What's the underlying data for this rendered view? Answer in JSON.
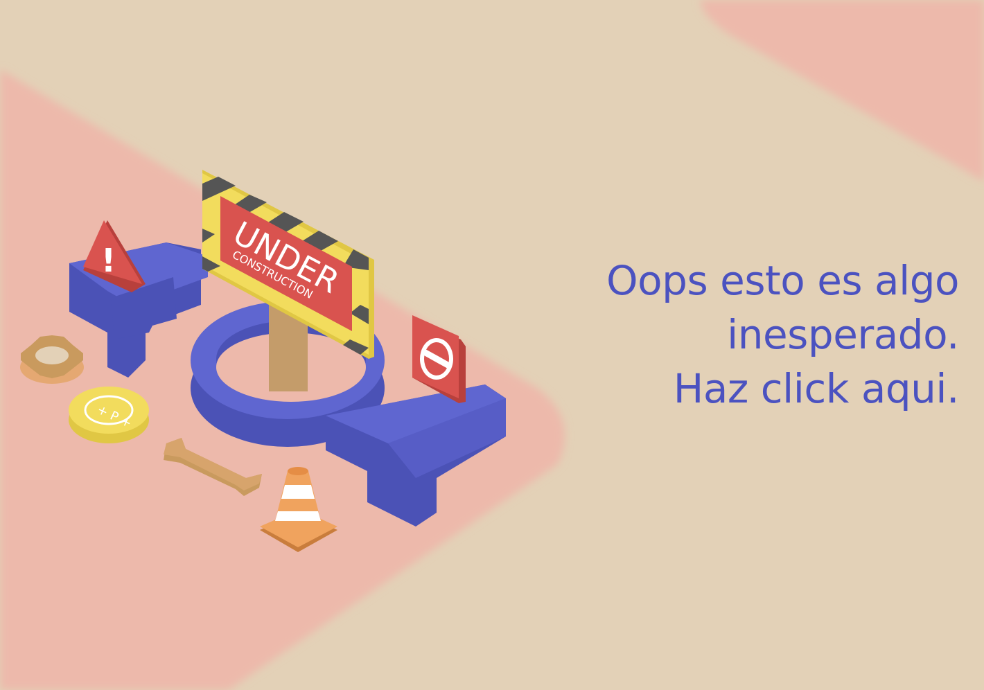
{
  "colors": {
    "background": "#e3d1b7",
    "pink": "#edb9ab",
    "accent_blue": "#4b52c0",
    "sign_red": "#d9534f",
    "caution_yellow": "#f2dc5d",
    "cone_orange": "#f0a35e"
  },
  "illustration": {
    "sign_title": "UNDER",
    "sign_subtitle": "CONSTRUCTION",
    "warning_symbol": "!",
    "icons": [
      "warning-triangle-icon",
      "no-entry-icon",
      "gear-icon",
      "coin-icon",
      "wrench-icon",
      "traffic-cone-icon"
    ]
  },
  "message": {
    "line1": "Oops esto es algo",
    "line2": "inesperado.",
    "line3": "Haz click aqui."
  }
}
